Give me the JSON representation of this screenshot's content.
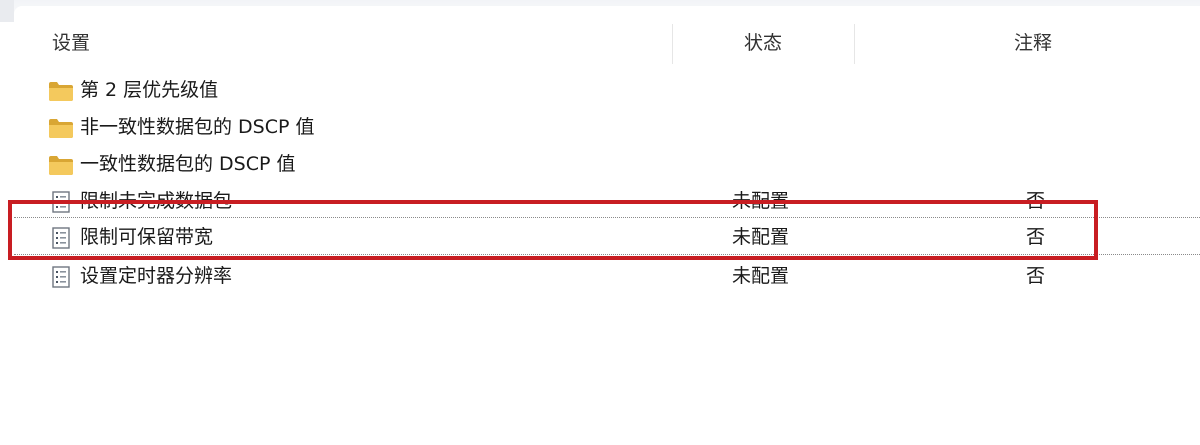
{
  "columns": {
    "setting": "设置",
    "state": "状态",
    "note": "注释"
  },
  "rows": [
    {
      "type": "folder",
      "icon": "folder-icon",
      "name": "第 2 层优先级值",
      "state": "",
      "note": ""
    },
    {
      "type": "folder",
      "icon": "folder-icon",
      "name": "非一致性数据包的 DSCP 值",
      "state": "",
      "note": ""
    },
    {
      "type": "folder",
      "icon": "folder-icon",
      "name": "一致性数据包的 DSCP 值",
      "state": "",
      "note": ""
    },
    {
      "type": "policy",
      "icon": "policy-setting-icon",
      "name": "限制未完成数据包",
      "state": "未配置",
      "note": "否"
    },
    {
      "type": "policy",
      "icon": "policy-setting-icon",
      "name": "限制可保留带宽",
      "state": "未配置",
      "note": "否"
    },
    {
      "type": "policy",
      "icon": "policy-setting-icon",
      "name": "设置定时器分辨率",
      "state": "未配置",
      "note": "否"
    }
  ],
  "selected_row": "限制可保留带宽",
  "colors": {
    "highlight": "#c81d22",
    "folder": "#f4c95d",
    "folder_dark": "#d9a634"
  }
}
